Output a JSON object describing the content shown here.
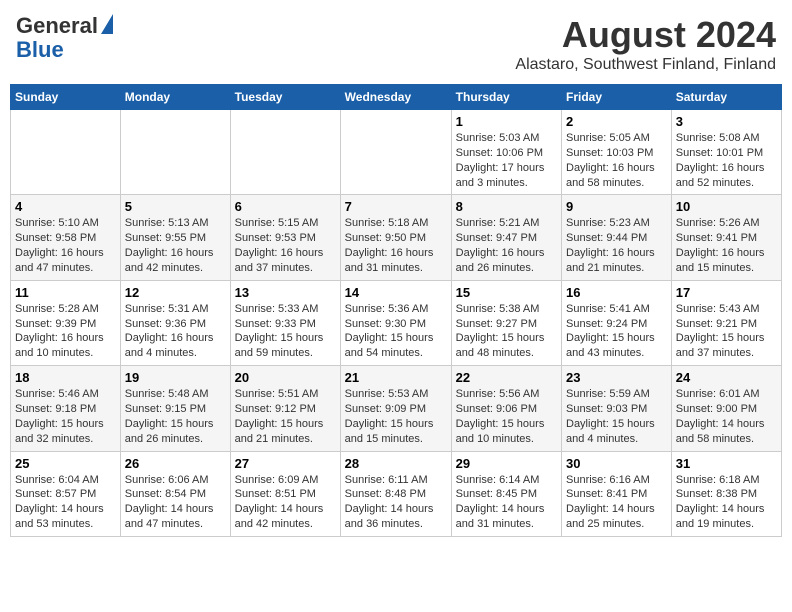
{
  "header": {
    "logo_line1": "General",
    "logo_line2": "Blue",
    "title": "August 2024",
    "subtitle": "Alastaro, Southwest Finland, Finland"
  },
  "columns": [
    "Sunday",
    "Monday",
    "Tuesday",
    "Wednesday",
    "Thursday",
    "Friday",
    "Saturday"
  ],
  "weeks": [
    [
      {
        "day": "",
        "detail": ""
      },
      {
        "day": "",
        "detail": ""
      },
      {
        "day": "",
        "detail": ""
      },
      {
        "day": "",
        "detail": ""
      },
      {
        "day": "1",
        "detail": "Sunrise: 5:03 AM\nSunset: 10:06 PM\nDaylight: 17 hours\nand 3 minutes."
      },
      {
        "day": "2",
        "detail": "Sunrise: 5:05 AM\nSunset: 10:03 PM\nDaylight: 16 hours\nand 58 minutes."
      },
      {
        "day": "3",
        "detail": "Sunrise: 5:08 AM\nSunset: 10:01 PM\nDaylight: 16 hours\nand 52 minutes."
      }
    ],
    [
      {
        "day": "4",
        "detail": "Sunrise: 5:10 AM\nSunset: 9:58 PM\nDaylight: 16 hours\nand 47 minutes."
      },
      {
        "day": "5",
        "detail": "Sunrise: 5:13 AM\nSunset: 9:55 PM\nDaylight: 16 hours\nand 42 minutes."
      },
      {
        "day": "6",
        "detail": "Sunrise: 5:15 AM\nSunset: 9:53 PM\nDaylight: 16 hours\nand 37 minutes."
      },
      {
        "day": "7",
        "detail": "Sunrise: 5:18 AM\nSunset: 9:50 PM\nDaylight: 16 hours\nand 31 minutes."
      },
      {
        "day": "8",
        "detail": "Sunrise: 5:21 AM\nSunset: 9:47 PM\nDaylight: 16 hours\nand 26 minutes."
      },
      {
        "day": "9",
        "detail": "Sunrise: 5:23 AM\nSunset: 9:44 PM\nDaylight: 16 hours\nand 21 minutes."
      },
      {
        "day": "10",
        "detail": "Sunrise: 5:26 AM\nSunset: 9:41 PM\nDaylight: 16 hours\nand 15 minutes."
      }
    ],
    [
      {
        "day": "11",
        "detail": "Sunrise: 5:28 AM\nSunset: 9:39 PM\nDaylight: 16 hours\nand 10 minutes."
      },
      {
        "day": "12",
        "detail": "Sunrise: 5:31 AM\nSunset: 9:36 PM\nDaylight: 16 hours\nand 4 minutes."
      },
      {
        "day": "13",
        "detail": "Sunrise: 5:33 AM\nSunset: 9:33 PM\nDaylight: 15 hours\nand 59 minutes."
      },
      {
        "day": "14",
        "detail": "Sunrise: 5:36 AM\nSunset: 9:30 PM\nDaylight: 15 hours\nand 54 minutes."
      },
      {
        "day": "15",
        "detail": "Sunrise: 5:38 AM\nSunset: 9:27 PM\nDaylight: 15 hours\nand 48 minutes."
      },
      {
        "day": "16",
        "detail": "Sunrise: 5:41 AM\nSunset: 9:24 PM\nDaylight: 15 hours\nand 43 minutes."
      },
      {
        "day": "17",
        "detail": "Sunrise: 5:43 AM\nSunset: 9:21 PM\nDaylight: 15 hours\nand 37 minutes."
      }
    ],
    [
      {
        "day": "18",
        "detail": "Sunrise: 5:46 AM\nSunset: 9:18 PM\nDaylight: 15 hours\nand 32 minutes."
      },
      {
        "day": "19",
        "detail": "Sunrise: 5:48 AM\nSunset: 9:15 PM\nDaylight: 15 hours\nand 26 minutes."
      },
      {
        "day": "20",
        "detail": "Sunrise: 5:51 AM\nSunset: 9:12 PM\nDaylight: 15 hours\nand 21 minutes."
      },
      {
        "day": "21",
        "detail": "Sunrise: 5:53 AM\nSunset: 9:09 PM\nDaylight: 15 hours\nand 15 minutes."
      },
      {
        "day": "22",
        "detail": "Sunrise: 5:56 AM\nSunset: 9:06 PM\nDaylight: 15 hours\nand 10 minutes."
      },
      {
        "day": "23",
        "detail": "Sunrise: 5:59 AM\nSunset: 9:03 PM\nDaylight: 15 hours\nand 4 minutes."
      },
      {
        "day": "24",
        "detail": "Sunrise: 6:01 AM\nSunset: 9:00 PM\nDaylight: 14 hours\nand 58 minutes."
      }
    ],
    [
      {
        "day": "25",
        "detail": "Sunrise: 6:04 AM\nSunset: 8:57 PM\nDaylight: 14 hours\nand 53 minutes."
      },
      {
        "day": "26",
        "detail": "Sunrise: 6:06 AM\nSunset: 8:54 PM\nDaylight: 14 hours\nand 47 minutes."
      },
      {
        "day": "27",
        "detail": "Sunrise: 6:09 AM\nSunset: 8:51 PM\nDaylight: 14 hours\nand 42 minutes."
      },
      {
        "day": "28",
        "detail": "Sunrise: 6:11 AM\nSunset: 8:48 PM\nDaylight: 14 hours\nand 36 minutes."
      },
      {
        "day": "29",
        "detail": "Sunrise: 6:14 AM\nSunset: 8:45 PM\nDaylight: 14 hours\nand 31 minutes."
      },
      {
        "day": "30",
        "detail": "Sunrise: 6:16 AM\nSunset: 8:41 PM\nDaylight: 14 hours\nand 25 minutes."
      },
      {
        "day": "31",
        "detail": "Sunrise: 6:18 AM\nSunset: 8:38 PM\nDaylight: 14 hours\nand 19 minutes."
      }
    ]
  ]
}
